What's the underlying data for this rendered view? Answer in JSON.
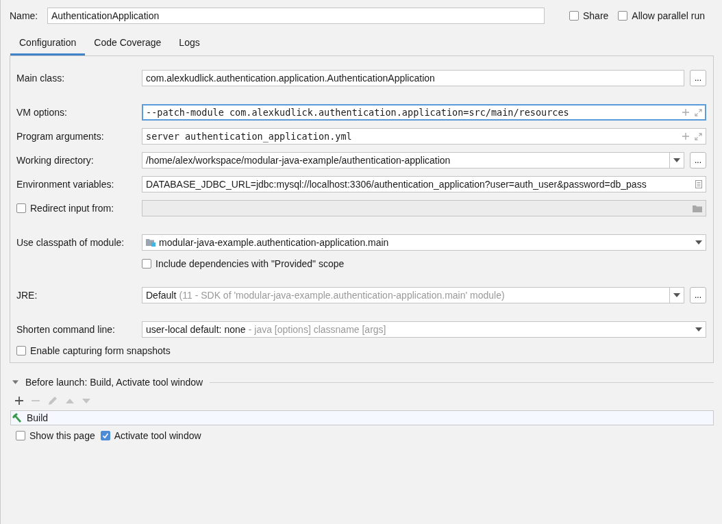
{
  "name_field": {
    "label": "Name:",
    "value": "AuthenticationApplication"
  },
  "header_options": [
    {
      "label": "Share",
      "checked": false
    },
    {
      "label": "Allow parallel run",
      "checked": false
    }
  ],
  "tabs": [
    {
      "label": "Configuration",
      "selected": true
    },
    {
      "label": "Code Coverage",
      "selected": false
    },
    {
      "label": "Logs",
      "selected": false
    }
  ],
  "config_groups": [
    [
      {
        "kind": "text",
        "label": "Main class:",
        "value": "com.alexkudlick.authentication.application.AuthenticationApplication",
        "browse_label": "..."
      }
    ],
    [
      {
        "kind": "expandable",
        "label": "VM options:",
        "value": "--patch-module com.alexkudlick.authentication.application=src/main/resources",
        "focused": true
      },
      {
        "kind": "expandable",
        "label": "Program arguments:",
        "value": "server authentication_application.yml",
        "focused": false
      },
      {
        "kind": "combo",
        "label": "Working directory:",
        "value": "/home/alex/workspace/modular-java-example/authentication-application",
        "browse_label": "..."
      },
      {
        "kind": "env",
        "label": "Environment variables:",
        "value": "DATABASE_JDBC_URL=jdbc:mysql://localhost:3306/authentication_application?user=auth_user&password=db_pass"
      },
      {
        "kind": "redirect",
        "label": "Redirect input from:",
        "checked": false
      }
    ],
    [
      {
        "kind": "module",
        "label": "Use classpath of module:",
        "value": "modular-java-example.authentication-application.main"
      },
      {
        "kind": "option",
        "label": "Include dependencies with \"Provided\" scope",
        "checked": false
      }
    ],
    [
      {
        "kind": "combo",
        "label": "JRE:",
        "value": "Default",
        "hint": "(11 - SDK of 'modular-java-example.authentication-application.main' module)",
        "browse_label": "..."
      }
    ],
    [
      {
        "kind": "combo",
        "label": "Shorten command line:",
        "value": "user-local default: none",
        "hint": "- java [options] classname [args]"
      },
      {
        "kind": "checkbox",
        "label": "Enable capturing form snapshots",
        "checked": false
      }
    ]
  ],
  "before_launch": {
    "title": "Before launch: Build, Activate tool window",
    "expanded": true,
    "toolbar": [
      {
        "kind": "add",
        "disabled": false
      },
      {
        "kind": "remove",
        "disabled": true
      },
      {
        "kind": "edit",
        "disabled": true
      },
      {
        "kind": "up",
        "disabled": true
      },
      {
        "kind": "down",
        "disabled": true
      }
    ],
    "tasks": [
      {
        "label": "Build"
      }
    ],
    "options": [
      {
        "label": "Show this page",
        "checked": false
      },
      {
        "label": "Activate tool window",
        "checked": true
      }
    ]
  }
}
